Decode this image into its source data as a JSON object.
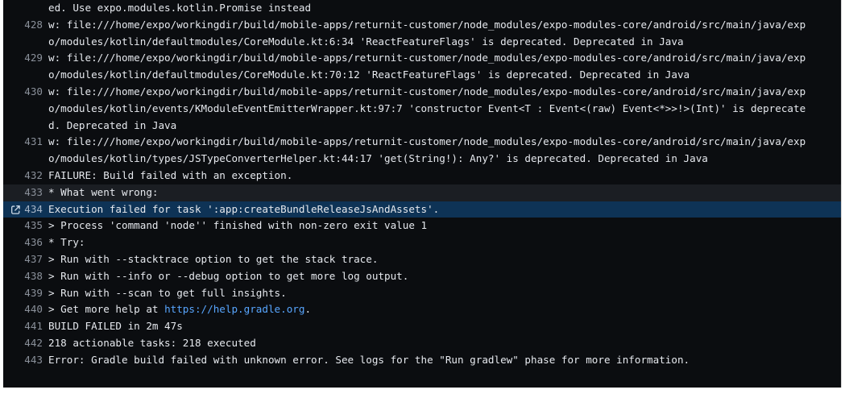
{
  "log": {
    "lines": [
      {
        "num": "",
        "text": "ed. Use expo.modules.kotlin.Promise instead"
      },
      {
        "num": "428",
        "text": "w: file:///home/expo/workingdir/build/mobile-apps/returnit-customer/node_modules/expo-modules-core/android/src/main/java/exp"
      },
      {
        "num": "",
        "text": "o/modules/kotlin/defaultmodules/CoreModule.kt:6:34 'ReactFeatureFlags' is deprecated. Deprecated in Java"
      },
      {
        "num": "429",
        "text": "w: file:///home/expo/workingdir/build/mobile-apps/returnit-customer/node_modules/expo-modules-core/android/src/main/java/exp"
      },
      {
        "num": "",
        "text": "o/modules/kotlin/defaultmodules/CoreModule.kt:70:12 'ReactFeatureFlags' is deprecated. Deprecated in Java"
      },
      {
        "num": "430",
        "text": "w: file:///home/expo/workingdir/build/mobile-apps/returnit-customer/node_modules/expo-modules-core/android/src/main/java/exp"
      },
      {
        "num": "",
        "text": "o/modules/kotlin/events/KModuleEventEmitterWrapper.kt:97:7 'constructor Event<T : Event<(raw) Event<*>>!>(Int)' is deprecate"
      },
      {
        "num": "",
        "text": "d. Deprecated in Java"
      },
      {
        "num": "431",
        "text": "w: file:///home/expo/workingdir/build/mobile-apps/returnit-customer/node_modules/expo-modules-core/android/src/main/java/exp"
      },
      {
        "num": "",
        "text": "o/modules/kotlin/types/JSTypeConverterHelper.kt:44:17 'get(String!): Any?' is deprecated. Deprecated in Java"
      },
      {
        "num": "432",
        "text": "FAILURE: Build failed with an exception."
      },
      {
        "num": "433",
        "text": "* What went wrong:"
      },
      {
        "num": "434",
        "text": "Execution failed for task ':app:createBundleReleaseJsAndAssets'."
      },
      {
        "num": "435",
        "text": "> Process 'command 'node'' finished with non-zero exit value 1"
      },
      {
        "num": "436",
        "text": "* Try:"
      },
      {
        "num": "437",
        "text": "> Run with --stacktrace option to get the stack trace."
      },
      {
        "num": "438",
        "text": "> Run with --info or --debug option to get more log output."
      },
      {
        "num": "439",
        "text": "> Run with --scan to get full insights."
      },
      {
        "num": "440",
        "text_before": "> Get more help at ",
        "link": "https://help.gradle.org",
        "text_after": "."
      },
      {
        "num": "441",
        "text": "BUILD FAILED in 2m 47s"
      },
      {
        "num": "442",
        "text": "218 actionable tasks: 218 executed"
      },
      {
        "num": "443",
        "text": "Error: Gradle build failed with unknown error. See logs for the \"Run gradlew\" phase for more information."
      }
    ],
    "link_icon": "copy-link-icon"
  },
  "colors": {
    "background": "#0b0d10",
    "line_number": "#8a909a",
    "text": "#e6e9ee",
    "selected_row": "#0e3356",
    "hover_row": "#1b1e23",
    "link": "#58a6ff"
  }
}
